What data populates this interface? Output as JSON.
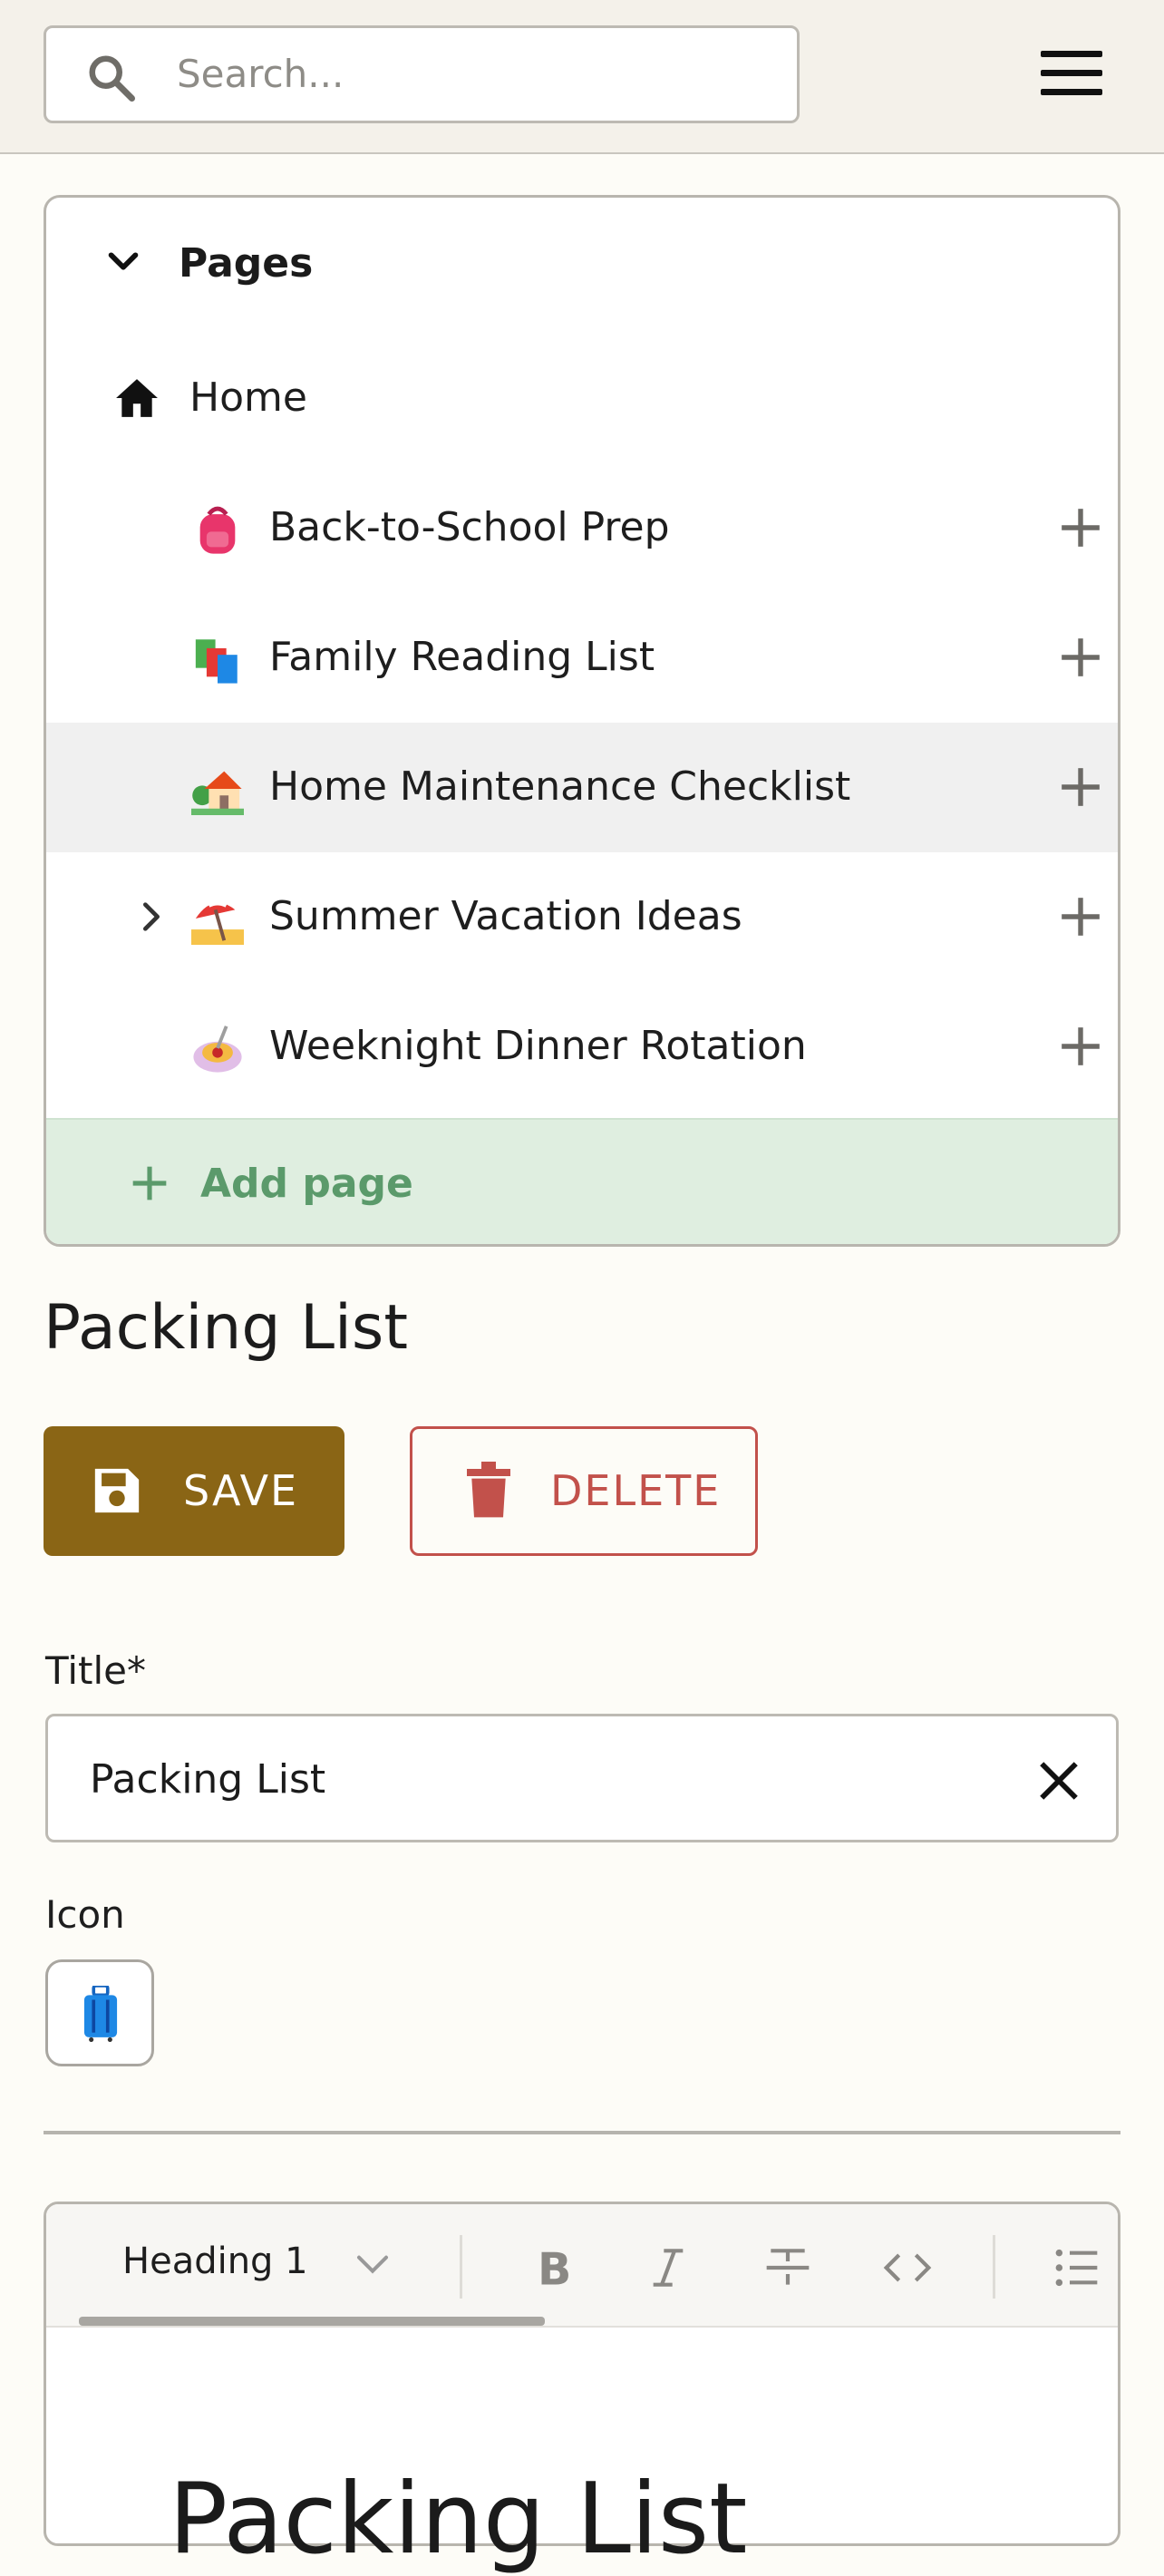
{
  "search": {
    "placeholder": "Search..."
  },
  "menu_icon": "hamburger-menu-icon",
  "pages_panel": {
    "header": "Pages",
    "home": {
      "label": "Home",
      "icon": "home-icon"
    },
    "items": [
      {
        "label": "Back-to-School Prep",
        "emoji": "backpack"
      },
      {
        "label": "Family Reading List",
        "emoji": "books"
      },
      {
        "label": "Home Maintenance Checklist",
        "emoji": "house-with-garden",
        "selected": true
      },
      {
        "label": "Summer Vacation Ideas",
        "emoji": "beach-umbrella",
        "has_children": true
      },
      {
        "label": "Weeknight Dinner Rotation",
        "emoji": "spaghetti"
      }
    ],
    "add_page": "Add page"
  },
  "page_title": "Packing List",
  "actions": {
    "save": "SAVE",
    "delete": "DELETE"
  },
  "form": {
    "title_label": "Title*",
    "title_value": "Packing List",
    "icon_label": "Icon",
    "icon_value": "luggage"
  },
  "editor": {
    "block_style": "Heading 1",
    "tools": [
      "bold",
      "italic",
      "strikethrough",
      "code",
      "bulleted-list"
    ],
    "content_heading": "Packing List"
  },
  "colors": {
    "topbar_bg": "#f4f1ea",
    "save_bg": "#8a6515",
    "delete": "#c2514b",
    "add_page_bg": "#dfeee0",
    "add_page_text": "#5b9a6b"
  }
}
